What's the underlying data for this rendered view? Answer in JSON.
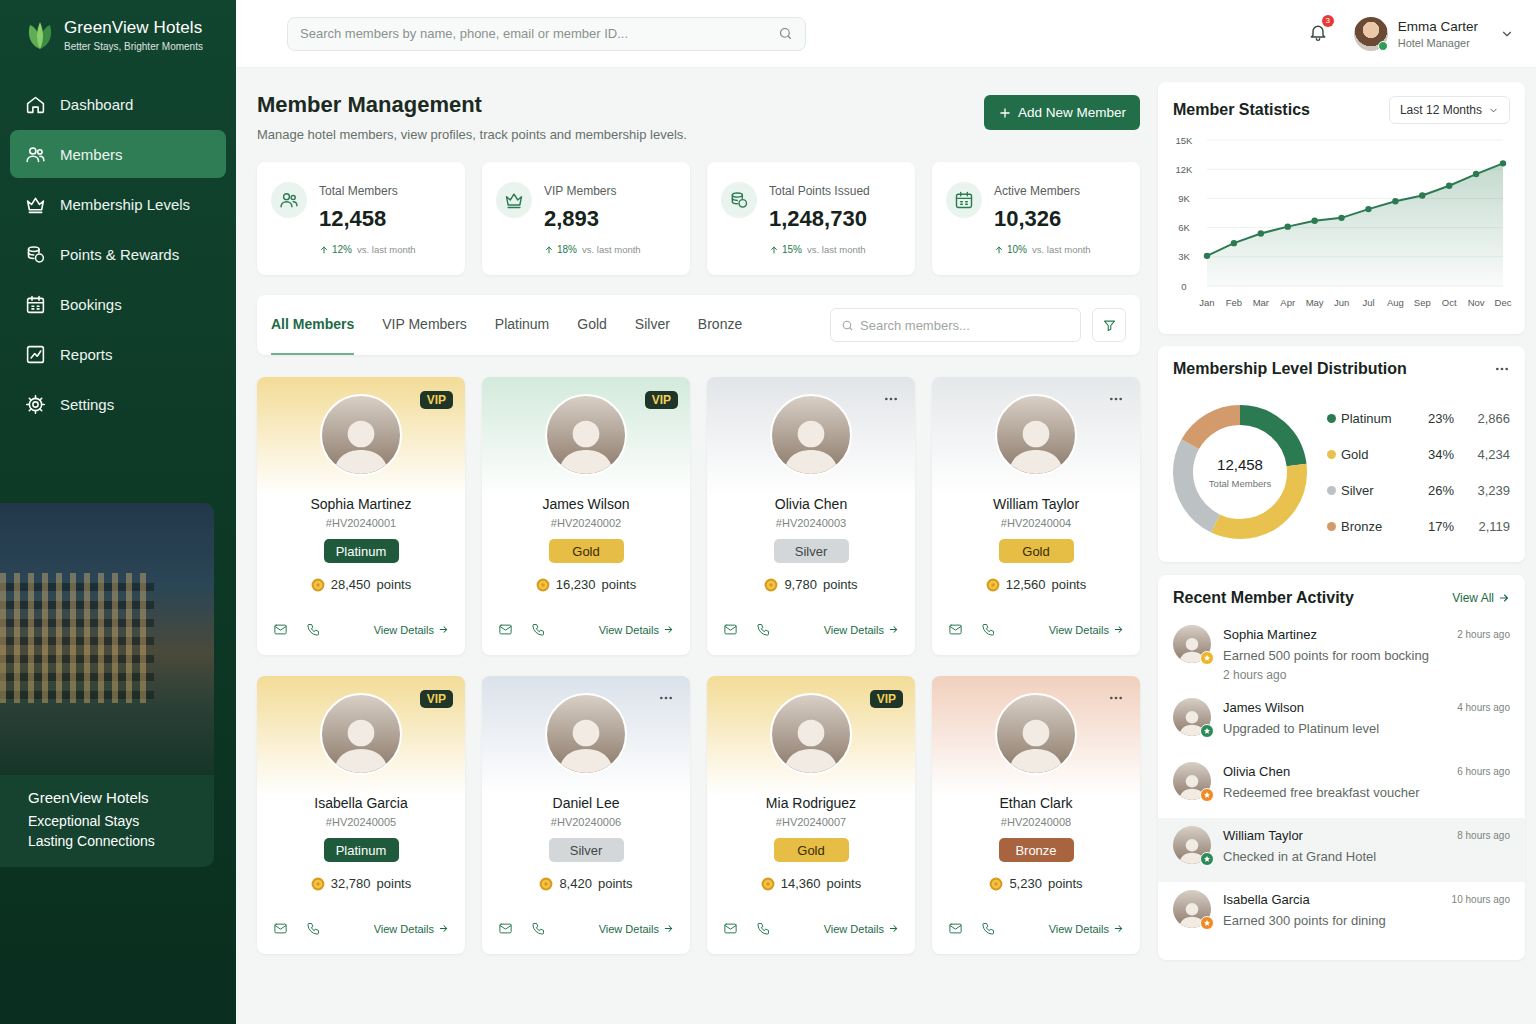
{
  "brand": {
    "name": "GreenView Hotels",
    "tagline": "Better Stays, Brighter Moments"
  },
  "sidebar": {
    "items": [
      {
        "label": "Dashboard",
        "selected": false
      },
      {
        "label": "Members",
        "selected": true
      },
      {
        "label": "Membership Levels",
        "selected": false
      },
      {
        "label": "Points & Rewards",
        "selected": false
      },
      {
        "label": "Bookings",
        "selected": false
      },
      {
        "label": "Reports",
        "selected": false
      },
      {
        "label": "Settings",
        "selected": false
      }
    ],
    "promo": {
      "title": "GreenView Hotels",
      "lines": [
        "Exceptional Stays",
        "Lasting Connections"
      ]
    }
  },
  "topbar": {
    "search": {
      "placeholder": "Search members by name, phone, email or member ID..."
    },
    "notifications": "3",
    "user": {
      "name": "Emma Carter",
      "role": "Hotel Manager"
    }
  },
  "header": {
    "title": "Member Management",
    "subtitle": "Manage hotel members, view profiles, track points and membership levels.",
    "add_button": "Add New Member"
  },
  "stats": [
    {
      "label": "Total Members",
      "value": "12,458",
      "change": "12%",
      "note": "vs. last month"
    },
    {
      "label": "VIP Members",
      "value": "2,893",
      "change": "18%",
      "note": "vs. last month"
    },
    {
      "label": "Total Points Issued",
      "value": "1,248,730",
      "change": "15%",
      "note": "vs. last month"
    },
    {
      "label": "Active Members",
      "value": "10,326",
      "change": "10%",
      "note": "vs. last month"
    }
  ],
  "filters": {
    "tabs": [
      {
        "label": "All Members",
        "selected": true
      },
      {
        "label": "VIP Members",
        "selected": false
      },
      {
        "label": "Platinum",
        "selected": false
      },
      {
        "label": "Gold",
        "selected": false
      },
      {
        "label": "Silver",
        "selected": false
      },
      {
        "label": "Bronze",
        "selected": false
      }
    ],
    "search": {
      "placeholder": "Search members..."
    }
  },
  "members": [
    {
      "name": "Sophia Martinez",
      "id": "#HV20240001",
      "vip": true,
      "vip_label": "VIP",
      "level": "Platinum",
      "level_color": "#1f5a3c",
      "points": "28,450",
      "points_unit": "points",
      "link": "View Details",
      "color": "#f3dc97"
    },
    {
      "name": "James Wilson",
      "id": "#HV20240002",
      "vip": true,
      "vip_label": "VIP",
      "level": "Gold",
      "level_color": "#e6bd45",
      "points": "16,230",
      "points_unit": "points",
      "link": "View Details",
      "color": "#d3eadc"
    },
    {
      "name": "Olivia Chen",
      "id": "#HV20240003",
      "vip": false,
      "level": "Silver",
      "level_color": "#d3d7da",
      "points": "9,780",
      "points_unit": "points",
      "link": "View Details",
      "color": "#e2e5e8"
    },
    {
      "name": "William Taylor",
      "id": "#HV20240004",
      "vip": false,
      "level": "Gold",
      "level_color": "#e6bd45",
      "points": "12,560",
      "points_unit": "points",
      "link": "View Details",
      "color": "#e5e8ea"
    },
    {
      "name": "Isabella Garcia",
      "id": "#HV20240005",
      "vip": true,
      "vip_label": "VIP",
      "level": "Platinum",
      "level_color": "#1f5a3c",
      "points": "32,780",
      "points_unit": "points",
      "link": "View Details",
      "color": "#f3dc97"
    },
    {
      "name": "Daniel Lee",
      "id": "#HV20240006",
      "vip": false,
      "level": "Silver",
      "level_color": "#d3d7da",
      "points": "8,420",
      "points_unit": "points",
      "link": "View Details",
      "color": "#dbe2ea"
    },
    {
      "name": "Mia Rodriguez",
      "id": "#HV20240007",
      "vip": true,
      "vip_label": "VIP",
      "level": "Gold",
      "level_color": "#e6bd45",
      "points": "14,360",
      "points_unit": "points",
      "link": "View Details",
      "color": "#f3dc97"
    },
    {
      "name": "Ethan Clark",
      "id": "#HV20240008",
      "vip": false,
      "level": "Bronze",
      "level_color": "#a8643f",
      "points": "5,230",
      "points_unit": "points",
      "link": "View Details",
      "color": "#f1d0bd"
    }
  ],
  "chart": {
    "title": "Member Statistics",
    "range": "Last 12 Months",
    "y_ticks": [
      "15K",
      "12K",
      "9K",
      "6K",
      "3K",
      "0"
    ],
    "x_labels": [
      "Jan",
      "Feb",
      "Mar",
      "Apr",
      "May",
      "Jun",
      "Jul",
      "Aug",
      "Sep",
      "Oct",
      "Nov",
      "Dec"
    ],
    "series": [
      {
        "name": "Members",
        "values": [
          3100,
          4400,
          5400,
          6100,
          6700,
          7000,
          7900,
          8700,
          9300,
          10300,
          11500,
          12600
        ]
      }
    ]
  },
  "distribution": {
    "title": "Membership Level Distribution",
    "total": "12,458",
    "total_label": "Total Members",
    "levels": [
      {
        "label": "Platinum",
        "pct": "23%",
        "count": "2,866",
        "share": 0.23,
        "color": "#2b7a52"
      },
      {
        "label": "Gold",
        "pct": "34%",
        "count": "4,234",
        "share": 0.34,
        "color": "#e8c14e"
      },
      {
        "label": "Silver",
        "pct": "26%",
        "count": "3,239",
        "share": 0.26,
        "color": "#bcc1c4"
      },
      {
        "label": "Bronze",
        "pct": "17%",
        "count": "2,119",
        "share": 0.17,
        "color": "#d39a6c"
      }
    ]
  },
  "activity": {
    "title": "Recent Member Activity",
    "view_all": "View All",
    "items": [
      {
        "name": "Sophia Martinez",
        "text": "Earned 500 points for room bocking",
        "detail": "2 hours ago",
        "time": "2 hours ago",
        "badge_color": "#f0b429",
        "selected": false
      },
      {
        "name": "James Wilson",
        "text": "Upgraded to Platinum level",
        "time": "4 hours ago",
        "badge_color": "#2e8b57",
        "selected": false
      },
      {
        "name": "Olivia Chen",
        "text": "Redeemed free breakfast voucher",
        "time": "6 hours ago",
        "badge_color": "#f08a24",
        "selected": false
      },
      {
        "name": "William Taylor",
        "text": "Checked in at Grand Hotel",
        "time": "8 hours ago",
        "badge_color": "#2e8b57",
        "selected": true
      },
      {
        "name": "Isabella Garcia",
        "text": "Earned 300 points for dining",
        "time": "10 hours ago",
        "badge_color": "#f08a24",
        "selected": false
      }
    ]
  }
}
